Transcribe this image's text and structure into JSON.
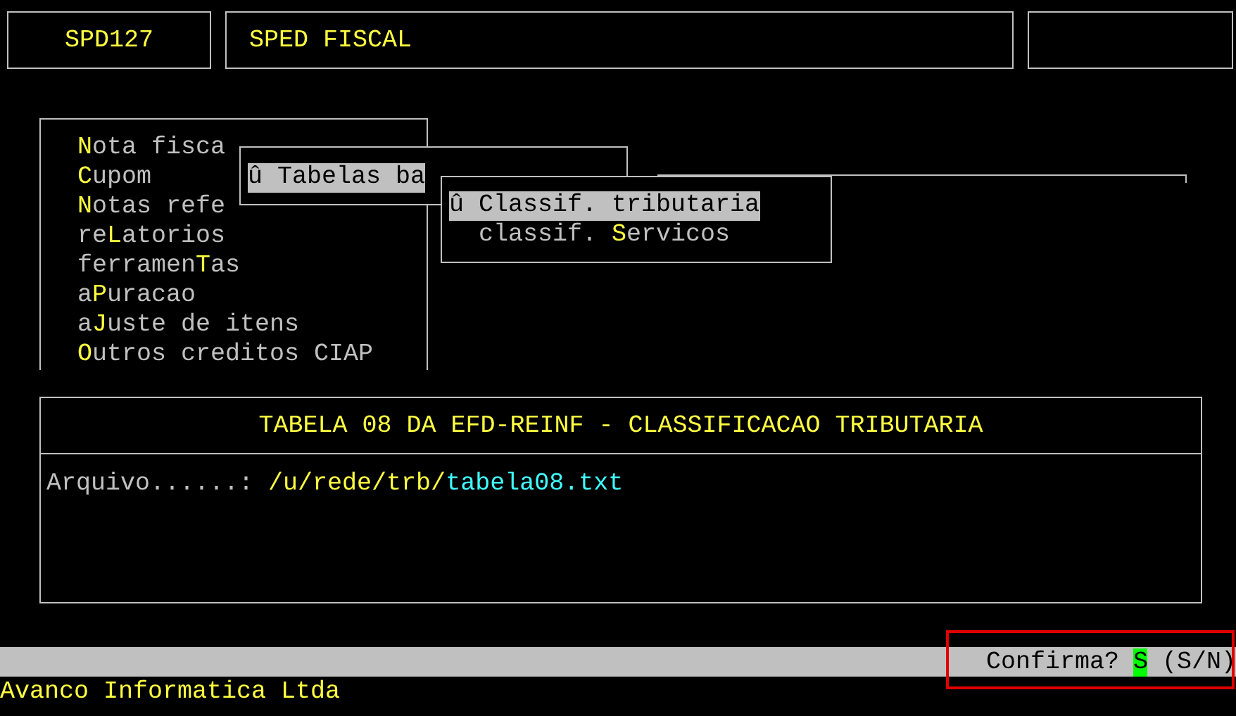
{
  "header": {
    "program_code": "SPD127",
    "title": "SPED FISCAL"
  },
  "main_menu": {
    "items": [
      {
        "label": "**N**ota fisca",
        "selected": false
      },
      {
        "label": "**C**upom",
        "selected": false
      },
      {
        "label": "**N**otas refe",
        "selected": false
      },
      {
        "label": "re**L**atorios",
        "selected": false
      },
      {
        "label": "ferramen**T**as",
        "selected": false
      },
      {
        "label": "a**P**uracao",
        "selected": false
      },
      {
        "label": "a**J**uste de itens",
        "selected": false
      },
      {
        "label": "**O**utros creditos CIAP",
        "selected": false
      }
    ]
  },
  "submenu": {
    "items": [
      {
        "label": "û Tabelas ba",
        "selected": true
      }
    ]
  },
  "submenu_2": {
    "items": [
      {
        "label": "û Classif. tributaria",
        "selected": true
      },
      {
        "label": "  classif. **S**ervicos",
        "selected": false
      }
    ]
  },
  "panel": {
    "title": "TABELA 08 DA EFD-REINF - CLASSIFICACAO TRIBUTARIA",
    "fields": [
      {
        "label": "Arquivo......: ",
        "value": "/u/rede/trb/**tabela08.txt**"
      }
    ]
  },
  "prompt": {
    "question": "Confirma?",
    "value": "S",
    "options": "(S/N)"
  },
  "footer": "Avanco Informatica Ltda"
}
